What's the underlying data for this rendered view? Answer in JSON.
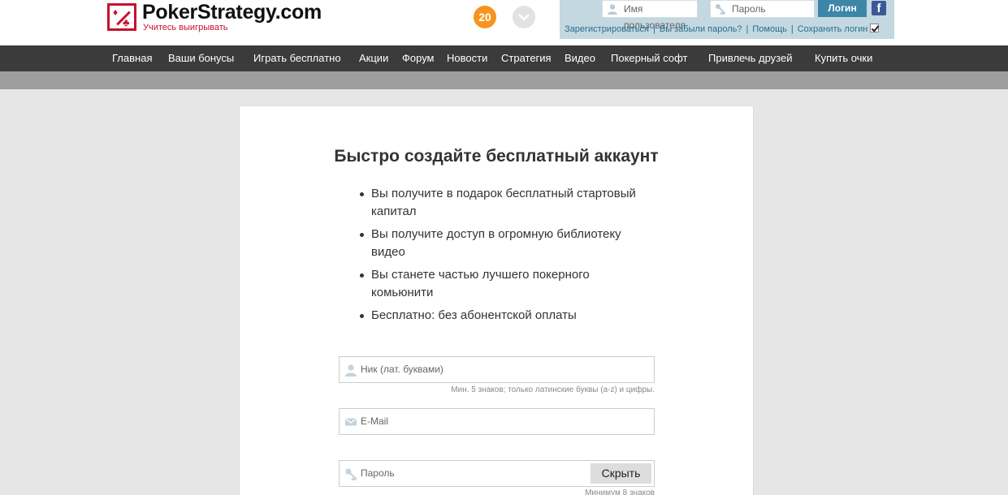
{
  "brand": {
    "name": "PokerStrategy.com",
    "tagline": "Учитесь выигрывать"
  },
  "header": {
    "badge_count": "20",
    "login": {
      "username_placeholder": "Имя пользователя",
      "password_placeholder": "Пароль",
      "login_label": "Логин",
      "facebook_label": "f",
      "links": [
        "Зарегистрироваться",
        "Вы забыли пароль?",
        "Помощь",
        "Сохранить логин"
      ],
      "remember_checked": true
    }
  },
  "nav": {
    "items": [
      "Главная",
      "Ваши бонусы",
      "Играть бесплатно",
      "Акции",
      "Форум",
      "Новости",
      "Стратегия",
      "Видео",
      "Покерный софт",
      "Привлечь друзей",
      "Купить очки"
    ]
  },
  "signup": {
    "title": "Быстро создайте бесплатный аккаунт",
    "benefits": [
      "Вы получите в подарок бесплатный стартовый капитал",
      "Вы получите доступ в огромную библиотеку видео",
      "Вы станете частью лучшего покерного комьюнити",
      "Бесплатно: без абонентской оплаты"
    ],
    "nick_placeholder": "Ник (лат. буквами)",
    "nick_hint": "Мин. 5 знаков; только латинские буквы (a-z) и цифры.",
    "email_placeholder": "E-Mail",
    "password_placeholder": "Пароль",
    "show_password_label": "Скрыть",
    "password_hint": "Минимум 8 знаков"
  },
  "colors": {
    "brand_red": "#c8102e",
    "badge_orange": "#f7941d",
    "login_blue": "#3e86a8",
    "nav_dark": "#3b3b3b"
  }
}
